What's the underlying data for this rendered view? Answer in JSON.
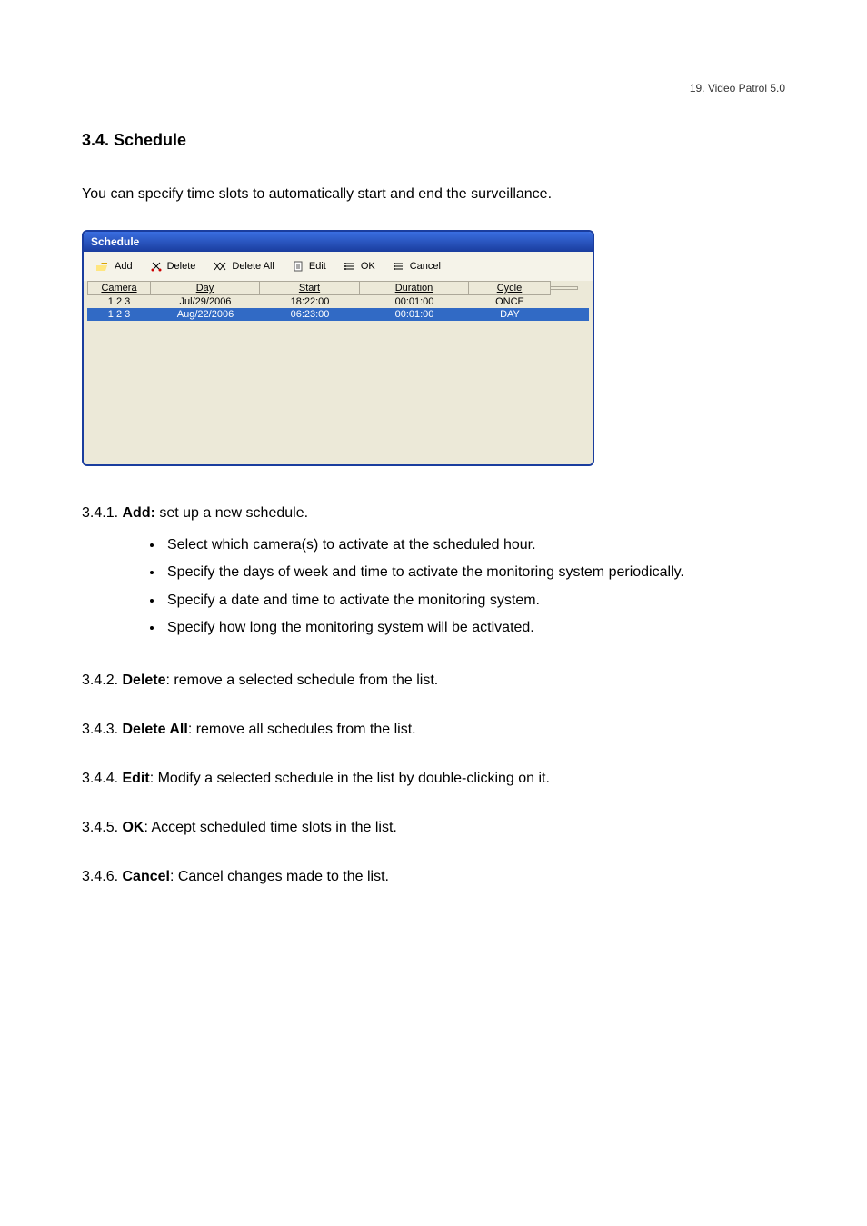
{
  "header": {
    "right": "19. Video Patrol 5.0"
  },
  "section": {
    "title": "3.4. Schedule",
    "intro": "You can specify time slots to automatically start and end the surveillance."
  },
  "dialog": {
    "title": "Schedule",
    "toolbar": {
      "add": "Add",
      "delete": "Delete",
      "delete_all": "Delete All",
      "edit": "Edit",
      "ok": "OK",
      "cancel": "Cancel"
    },
    "columns": [
      "Camera",
      "Day",
      "Start",
      "Duration",
      "Cycle",
      ""
    ],
    "rows": [
      {
        "camera": "1 2 3",
        "day": "Jul/29/2006",
        "start": "18:22:00",
        "duration": "00:01:00",
        "cycle": "ONCE",
        "selected": false
      },
      {
        "camera": "1 2 3",
        "day": "Aug/22/2006",
        "start": "06:23:00",
        "duration": "00:01:00",
        "cycle": "DAY",
        "selected": true
      }
    ]
  },
  "items": {
    "add": {
      "num": "3.4.1. ",
      "label": "Add:",
      "text": " set up a new schedule.",
      "bullets": [
        "Select which camera(s) to activate at the scheduled hour.",
        "Specify the days of week and time to activate the monitoring system periodically.",
        "Specify a date and time to activate the monitoring system.",
        "Specify how long the monitoring system will be activated."
      ]
    },
    "delete": {
      "num": "3.4.2. ",
      "label": "Delete",
      "text": ": remove a selected schedule from the list."
    },
    "delete_all": {
      "num": "3.4.3. ",
      "label": "Delete All",
      "text": ": remove all schedules from the list."
    },
    "edit": {
      "num": "3.4.4. ",
      "label": "Edit",
      "text": ": Modify a selected schedule in the list by double-clicking on it."
    },
    "ok": {
      "num": "3.4.5. ",
      "label": "OK",
      "text": ": Accept scheduled time slots in the list."
    },
    "cancel": {
      "num": "3.4.6. ",
      "label": "Cancel",
      "text": ": Cancel changes made to the list."
    }
  }
}
